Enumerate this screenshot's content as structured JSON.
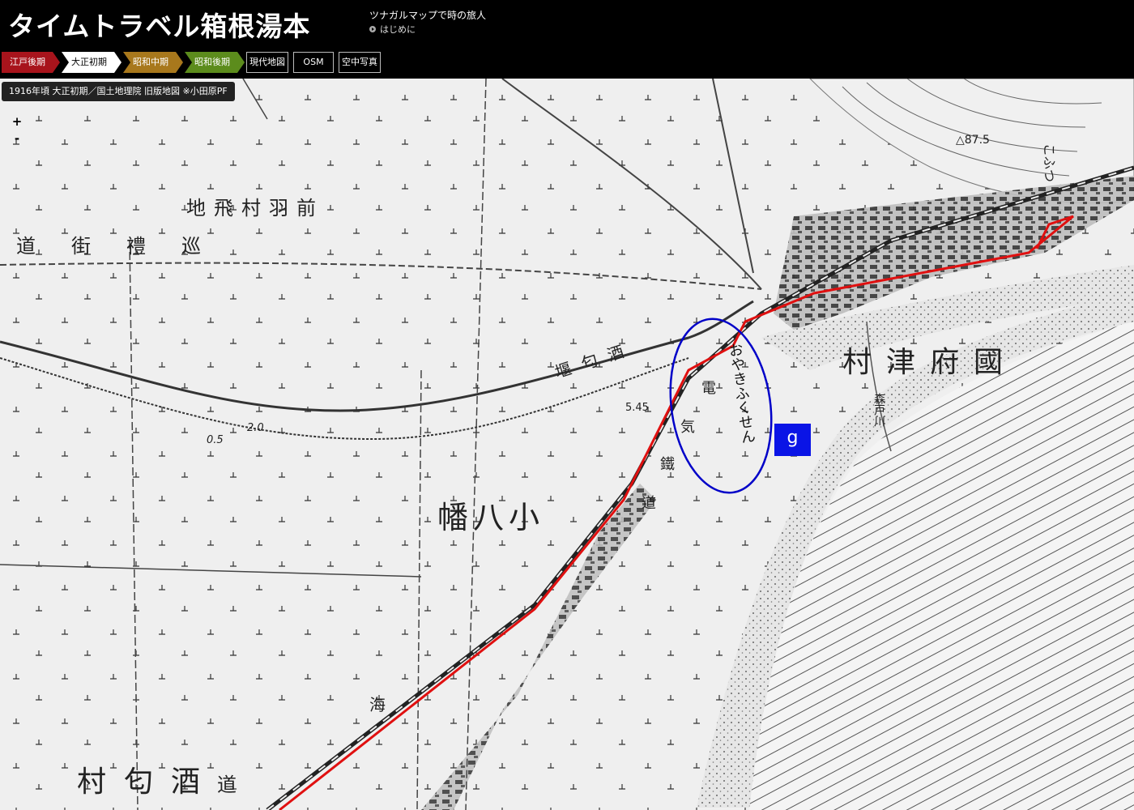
{
  "header": {
    "title": "タイムトラベル箱根湯本",
    "subtitle": "ツナガルマップで時の旅人",
    "intro_link": "はじめに"
  },
  "era_tabs": [
    {
      "label": "江戸後期",
      "bg": "#a8141c",
      "fg": "#ffffff"
    },
    {
      "label": "大正初期",
      "bg": "#ffffff",
      "fg": "#000000"
    },
    {
      "label": "昭和中期",
      "bg": "#a8781c",
      "fg": "#ffffff"
    },
    {
      "label": "昭和後期",
      "bg": "#5c8c1c",
      "fg": "#ffffff"
    }
  ],
  "layer_buttons": {
    "modern": "現代地図",
    "osm": "OSM",
    "aerial": "空中写真"
  },
  "map": {
    "attribution": "1916年頃 大正初期／国土地理院 旧版地図 ※小田原PF",
    "zoom_in": "+",
    "zoom_out": "-",
    "marker_label": "g",
    "route_color": "#e01010",
    "highlight_color": "#0000c8",
    "labels": {
      "road_a": "道街禮巡",
      "village_maebane": "地飛村羽前",
      "kozu_village": "村津府國",
      "yawata": "幡八小",
      "sakawa_village": "村匂酒",
      "oyakifukusen": "おやきふくせん",
      "river_morito": "森戸川",
      "embankment": "堰匂酒",
      "railway_a": "電",
      "railway_b": "気",
      "railway_c": "鐵",
      "railway_d": "道",
      "umi_kaido": "海",
      "kofu": "こふつ",
      "elev_875": "△87.5",
      "elev_545": "5.45",
      "contour_20": "2.0",
      "contour_05": "0.5",
      "sakawa_road": "道"
    }
  }
}
